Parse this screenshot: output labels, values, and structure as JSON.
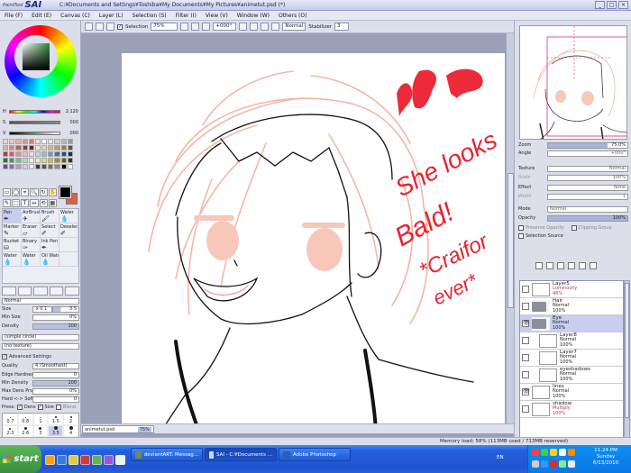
{
  "window": {
    "app_name": "SAI",
    "app_prefix": "PaintTool",
    "title": "C:¥Documents and Settings¥Toshiba¥My Documents¥My Pictures¥animetut.psd (*)",
    "buttons": [
      "_",
      "□",
      "×"
    ]
  },
  "menu": [
    "File (F)",
    "Edit (E)",
    "Canvas (C)",
    "Layer (L)",
    "Selection (S)",
    "Filter (I)",
    "View (V)",
    "Window (W)",
    "Others (O)"
  ],
  "toolbar": {
    "selection_label": "Selection",
    "zoom": "75%",
    "rotation": "+000°",
    "blend": "Normal",
    "stabilizer_label": "Stabilizer",
    "stabilizer_value": "3"
  },
  "color": {
    "h_label": "H",
    "h_value": "2:120",
    "s_label": "S",
    "s_value": "000",
    "v_label": "V",
    "v_value": "000",
    "foreground": "#000000",
    "background": "#e0613a",
    "swatches": [
      "#e8d4d0",
      "#f3c9c2",
      "#e6b2a8",
      "#d49a8f",
      "#c98276",
      "#f1dfd8",
      "#ffffff",
      "#e8e8e8",
      "#cfcfcf",
      "#b7b7b7",
      "#9c9c9c",
      "#d8b4a2",
      "#c6907c",
      "#a56a57",
      "#7e4a3b",
      "#5c3228",
      "#f6e7c9",
      "#e8d3a5",
      "#d7b77c",
      "#c29a5a",
      "#9d7a42",
      "#6d5430",
      "#b93b3b",
      "#d65a5a",
      "#ec8b8b",
      "#f4b8b8",
      "#fadcdc",
      "#b3d9ee",
      "#86bfe0",
      "#5a9fcf",
      "#3677b1",
      "#214f80",
      "#15315a",
      "#2d6b3e",
      "#4f935e",
      "#7fb98a",
      "#b3d9b9",
      "#e2f1e4",
      "#f3eab0",
      "#e7d56c",
      "#d8bf2f",
      "#a88f1d",
      "#6c5c14",
      "#3b3209",
      "#6a4b8f",
      "#8d6db0",
      "#b39ad0",
      "#d9cbea",
      "#f0e9f7",
      "#3a3a3a",
      "#555555",
      "#707070",
      "#8b8b8b",
      "#000000",
      "#ffffff"
    ]
  },
  "selection_tools": [
    "▭",
    "◯",
    "⌖",
    "🔍",
    "↻",
    "✋",
    "✎",
    "⬚",
    "T",
    "↔",
    "⟲",
    "▦"
  ],
  "brushes": [
    {
      "name": "Pen",
      "icon": "✒",
      "selected": true
    },
    {
      "name": "AirBrush",
      "icon": "✈",
      "selected": false
    },
    {
      "name": "Brush",
      "icon": "🖌",
      "selected": false
    },
    {
      "name": "Water",
      "icon": "💧",
      "selected": false
    },
    {
      "name": "Marker",
      "icon": "✎",
      "selected": false
    },
    {
      "name": "Eraser",
      "icon": "▱",
      "selected": false
    },
    {
      "name": "Select",
      "icon": "✐",
      "selected": false
    },
    {
      "name": "Deselect",
      "icon": "✐",
      "selected": false
    },
    {
      "name": "Bucket",
      "icon": "⛁",
      "selected": false
    },
    {
      "name": "Binary",
      "icon": "✑",
      "selected": false
    },
    {
      "name": "Ink Pen",
      "icon": "✒",
      "selected": false
    },
    {
      "name": "",
      "icon": "",
      "selected": false
    },
    {
      "name": "Water",
      "icon": "💧",
      "selected": false
    },
    {
      "name": "Water",
      "icon": "💧",
      "selected": false
    },
    {
      "name": "Oil Wate",
      "icon": "💧",
      "selected": false
    },
    {
      "name": "",
      "icon": "",
      "selected": false
    }
  ],
  "brush_props": {
    "blend": "Normal",
    "size_label": "Size",
    "size_mult": "x 0.1",
    "size_value": "3.5",
    "min_size_label": "Min Size",
    "min_size_value": "0%",
    "density_label": "Density",
    "density_value": "100",
    "shape": "(simple circle)",
    "texture": "(no texture)",
    "advanced_label": "Advanced Settings",
    "quality_label": "Quality",
    "quality_value": "4 (Smoothest)",
    "edge_label": "Edge Hardness",
    "edge_value": "0",
    "min_density_label": "Min Density",
    "min_density_value": "100",
    "max_dens_label": "Max Dens Prs.",
    "max_dens_value": "0%",
    "hard_soft_label": "Hard <-> Soft",
    "hard_soft_value": "0",
    "press_label": "Press:",
    "press_opts": [
      "Dens",
      "Size",
      "Blend"
    ],
    "sizes": [
      "0.7",
      "0.8",
      "1",
      "1.5",
      "2",
      "2.3",
      "2.6",
      "3",
      "3.5",
      "4"
    ],
    "selected_size": "3.5"
  },
  "canvas": {
    "annotation_lines": [
      "She looks",
      "Bald!",
      "*Craifor",
      "ever*"
    ]
  },
  "doc_tab": {
    "name": "animetut.psd",
    "zoom": "75%"
  },
  "navigator": {
    "zoom_label": "Zoom",
    "zoom_value": "75.0%",
    "angle_label": "Angle",
    "angle_value": "+000°"
  },
  "layer_props": {
    "texture_label": "Texture",
    "texture_value": "Normal",
    "scale_label": "Scale",
    "scale_value": "100%",
    "effect_label": "Effect",
    "effect_value": "None",
    "width_label": "Width",
    "width_value": "1",
    "mode_label": "Mode",
    "mode_value": "Normal",
    "opacity_label": "Opacity",
    "opacity_value": "100%",
    "preserve_label": "Preserve Opacity",
    "clipping_label": "Clipping Group",
    "selection_source_label": "Selection Source"
  },
  "layers": [
    {
      "name": "Layer5",
      "mode": "Luminosity",
      "opacity": "46%",
      "type": "layer",
      "visible": false,
      "selected": false,
      "indent": false,
      "pink": true
    },
    {
      "name": "Hair",
      "mode": "Normal",
      "opacity": "100%",
      "type": "folder",
      "visible": false,
      "selected": false,
      "indent": false,
      "pink": false
    },
    {
      "name": "Eye",
      "mode": "Normal",
      "opacity": "100%",
      "type": "folder",
      "visible": true,
      "selected": true,
      "indent": false,
      "pink": false
    },
    {
      "name": "Layer8",
      "mode": "Normal",
      "opacity": "100%",
      "type": "layer",
      "visible": false,
      "selected": false,
      "indent": true,
      "pink": false
    },
    {
      "name": "Layer7",
      "mode": "Normal",
      "opacity": "100%",
      "type": "layer",
      "visible": false,
      "selected": false,
      "indent": true,
      "pink": false
    },
    {
      "name": "eyeshadows",
      "mode": "Normal",
      "opacity": "100%",
      "type": "layer",
      "visible": false,
      "selected": false,
      "indent": true,
      "pink": false
    },
    {
      "name": "lines",
      "mode": "Normal",
      "opacity": "100%",
      "type": "layer",
      "visible": true,
      "selected": false,
      "indent": false,
      "pink": false
    },
    {
      "name": "shadow",
      "mode": "Multiply",
      "opacity": "100%",
      "type": "layer",
      "visible": false,
      "selected": false,
      "indent": false,
      "pink": true
    }
  ],
  "status": {
    "memory": "Memory load: 58% (113MB used / 713MB reserved)"
  },
  "taskbar": {
    "start": "start",
    "buttons": [
      {
        "label": "deviantART: Messag...",
        "active": false
      },
      {
        "label": "SAI - C:¥Documents ...",
        "active": true
      },
      {
        "label": "Adobe Photoshop",
        "active": false
      }
    ],
    "lang": "EN",
    "time": "11:24 PM",
    "day": "Sunday",
    "date": "6/13/2010"
  }
}
